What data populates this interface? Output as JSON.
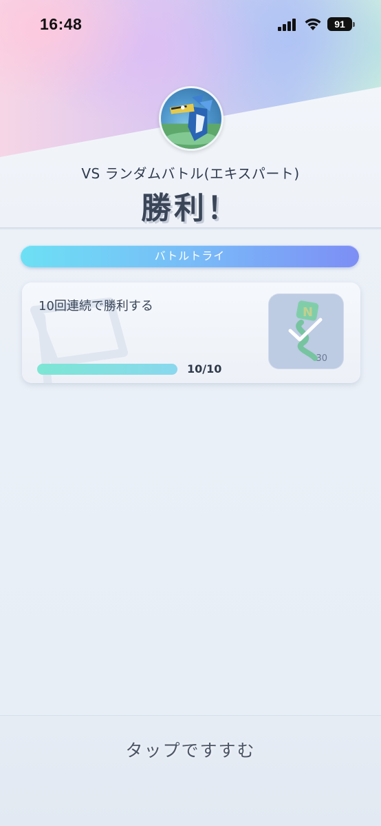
{
  "status_bar": {
    "time": "16:48",
    "battery": "91"
  },
  "header": {
    "mode": "VS ランダムバトル(エキスパート)",
    "result": "勝利！"
  },
  "battle_try": {
    "section_label": "バトルトライ",
    "mission": {
      "description": "10回連続で勝利する",
      "progress_text": "10/10",
      "progress_fraction": 1.0,
      "completed": true,
      "reward_count": "30"
    }
  },
  "footer": {
    "tap_prompt": "タップですすむ"
  },
  "colors": {
    "accent_pill_start": "#6de0f4",
    "accent_pill_end": "#7d8ef5",
    "result_text": "#3a4558",
    "progress_fill": "#7de6d4"
  }
}
